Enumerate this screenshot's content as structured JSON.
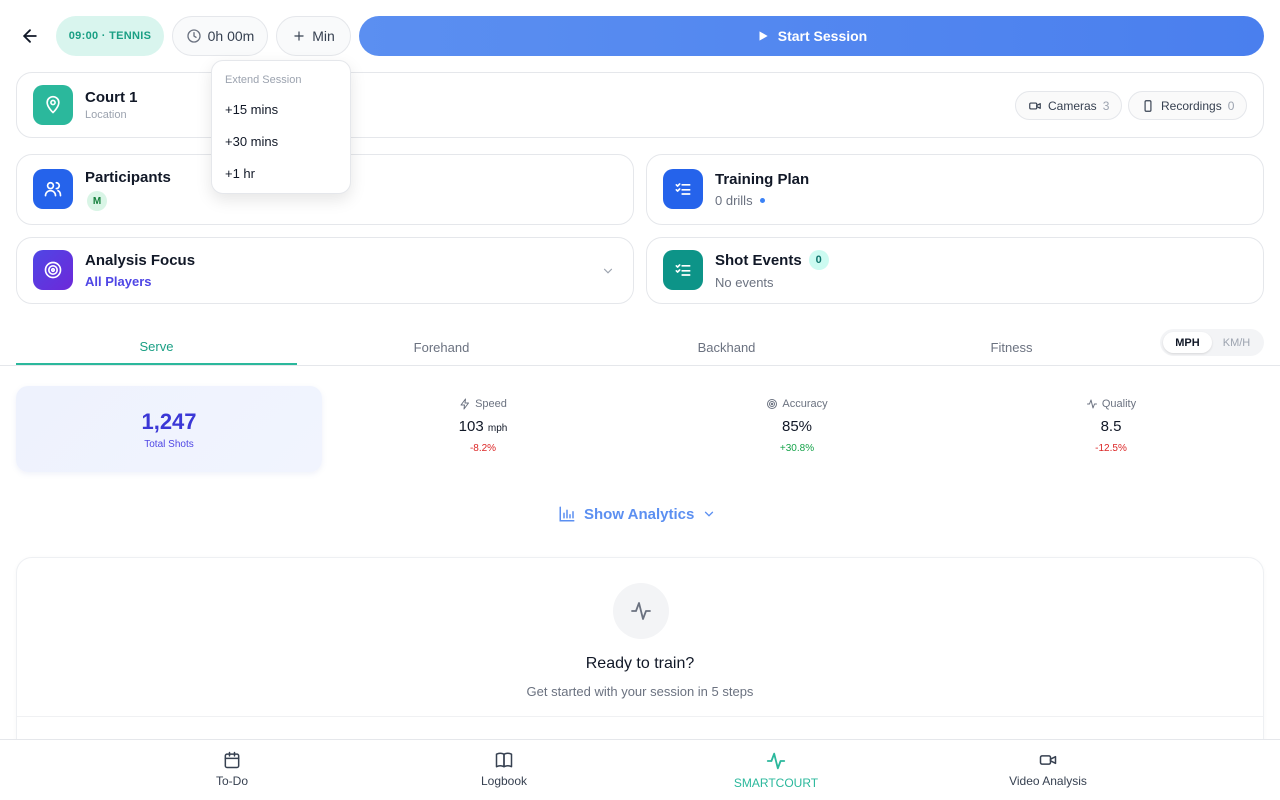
{
  "header": {
    "sport_pill": "09:00 · TENNIS",
    "timer": "0h 00m",
    "min_label": "Min",
    "start_label": "Start Session"
  },
  "extend_menu": {
    "title": "Extend Session",
    "items": [
      "+15 mins",
      "+30 mins",
      "+1 hr"
    ]
  },
  "court": {
    "title": "Court 1",
    "subtitle": "Location",
    "cameras_label": "Cameras",
    "cameras_count": "3",
    "recordings_label": "Recordings",
    "recordings_count": "0"
  },
  "participants": {
    "title": "Participants",
    "avatar_initial": "M"
  },
  "training_plan": {
    "title": "Training Plan",
    "subtitle": "0 drills"
  },
  "analysis_focus": {
    "title": "Analysis Focus",
    "value": "All Players"
  },
  "shot_events": {
    "title": "Shot Events",
    "count": "0",
    "subtitle": "No events"
  },
  "tabs": [
    "Serve",
    "Forehand",
    "Backhand",
    "Fitness"
  ],
  "units": [
    "MPH",
    "KM/H"
  ],
  "stats": {
    "total_value": "1,247",
    "total_label": "Total Shots",
    "speed": {
      "label": "Speed",
      "value": "103",
      "unit": "mph",
      "delta": "-8.2%"
    },
    "accuracy": {
      "label": "Accuracy",
      "value": "85%",
      "delta": "+30.8%"
    },
    "quality": {
      "label": "Quality",
      "value": "8.5",
      "delta": "-12.5%"
    }
  },
  "show_analytics": "Show Analytics",
  "ready": {
    "title": "Ready to train?",
    "subtitle": "Get started with your session in 5 steps"
  },
  "bottom_nav": [
    "To-Do",
    "Logbook",
    "SMARTCOURT",
    "Video Analysis"
  ],
  "colors": {
    "accent_teal": "#2bb89c",
    "primary_blue": "#4a7fee",
    "indigo": "#4f46e5",
    "negative": "#dc2626",
    "positive": "#16a34a"
  }
}
